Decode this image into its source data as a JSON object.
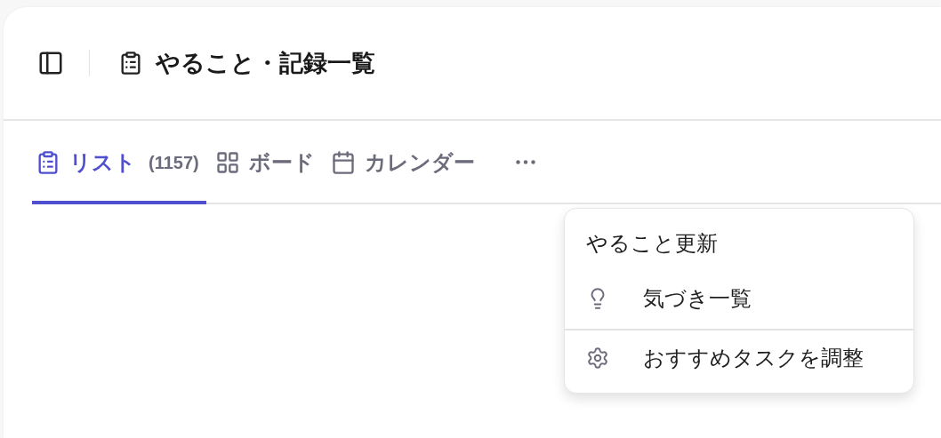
{
  "header": {
    "title": "やること・記録一覧"
  },
  "tabs": [
    {
      "kind": "list",
      "label": "リスト",
      "count": "(1157)",
      "selected": true
    },
    {
      "kind": "board",
      "label": "ボード",
      "selected": false
    },
    {
      "kind": "calendar",
      "label": "カレンダー",
      "selected": false
    }
  ],
  "menu": {
    "items": [
      {
        "kind": "plain",
        "label": "やること更新",
        "divider_before": false
      },
      {
        "kind": "idea",
        "label": "気づき一覧",
        "divider_before": false
      },
      {
        "kind": "settings",
        "label": "おすすめタスクを調整",
        "divider_before": true
      }
    ]
  }
}
